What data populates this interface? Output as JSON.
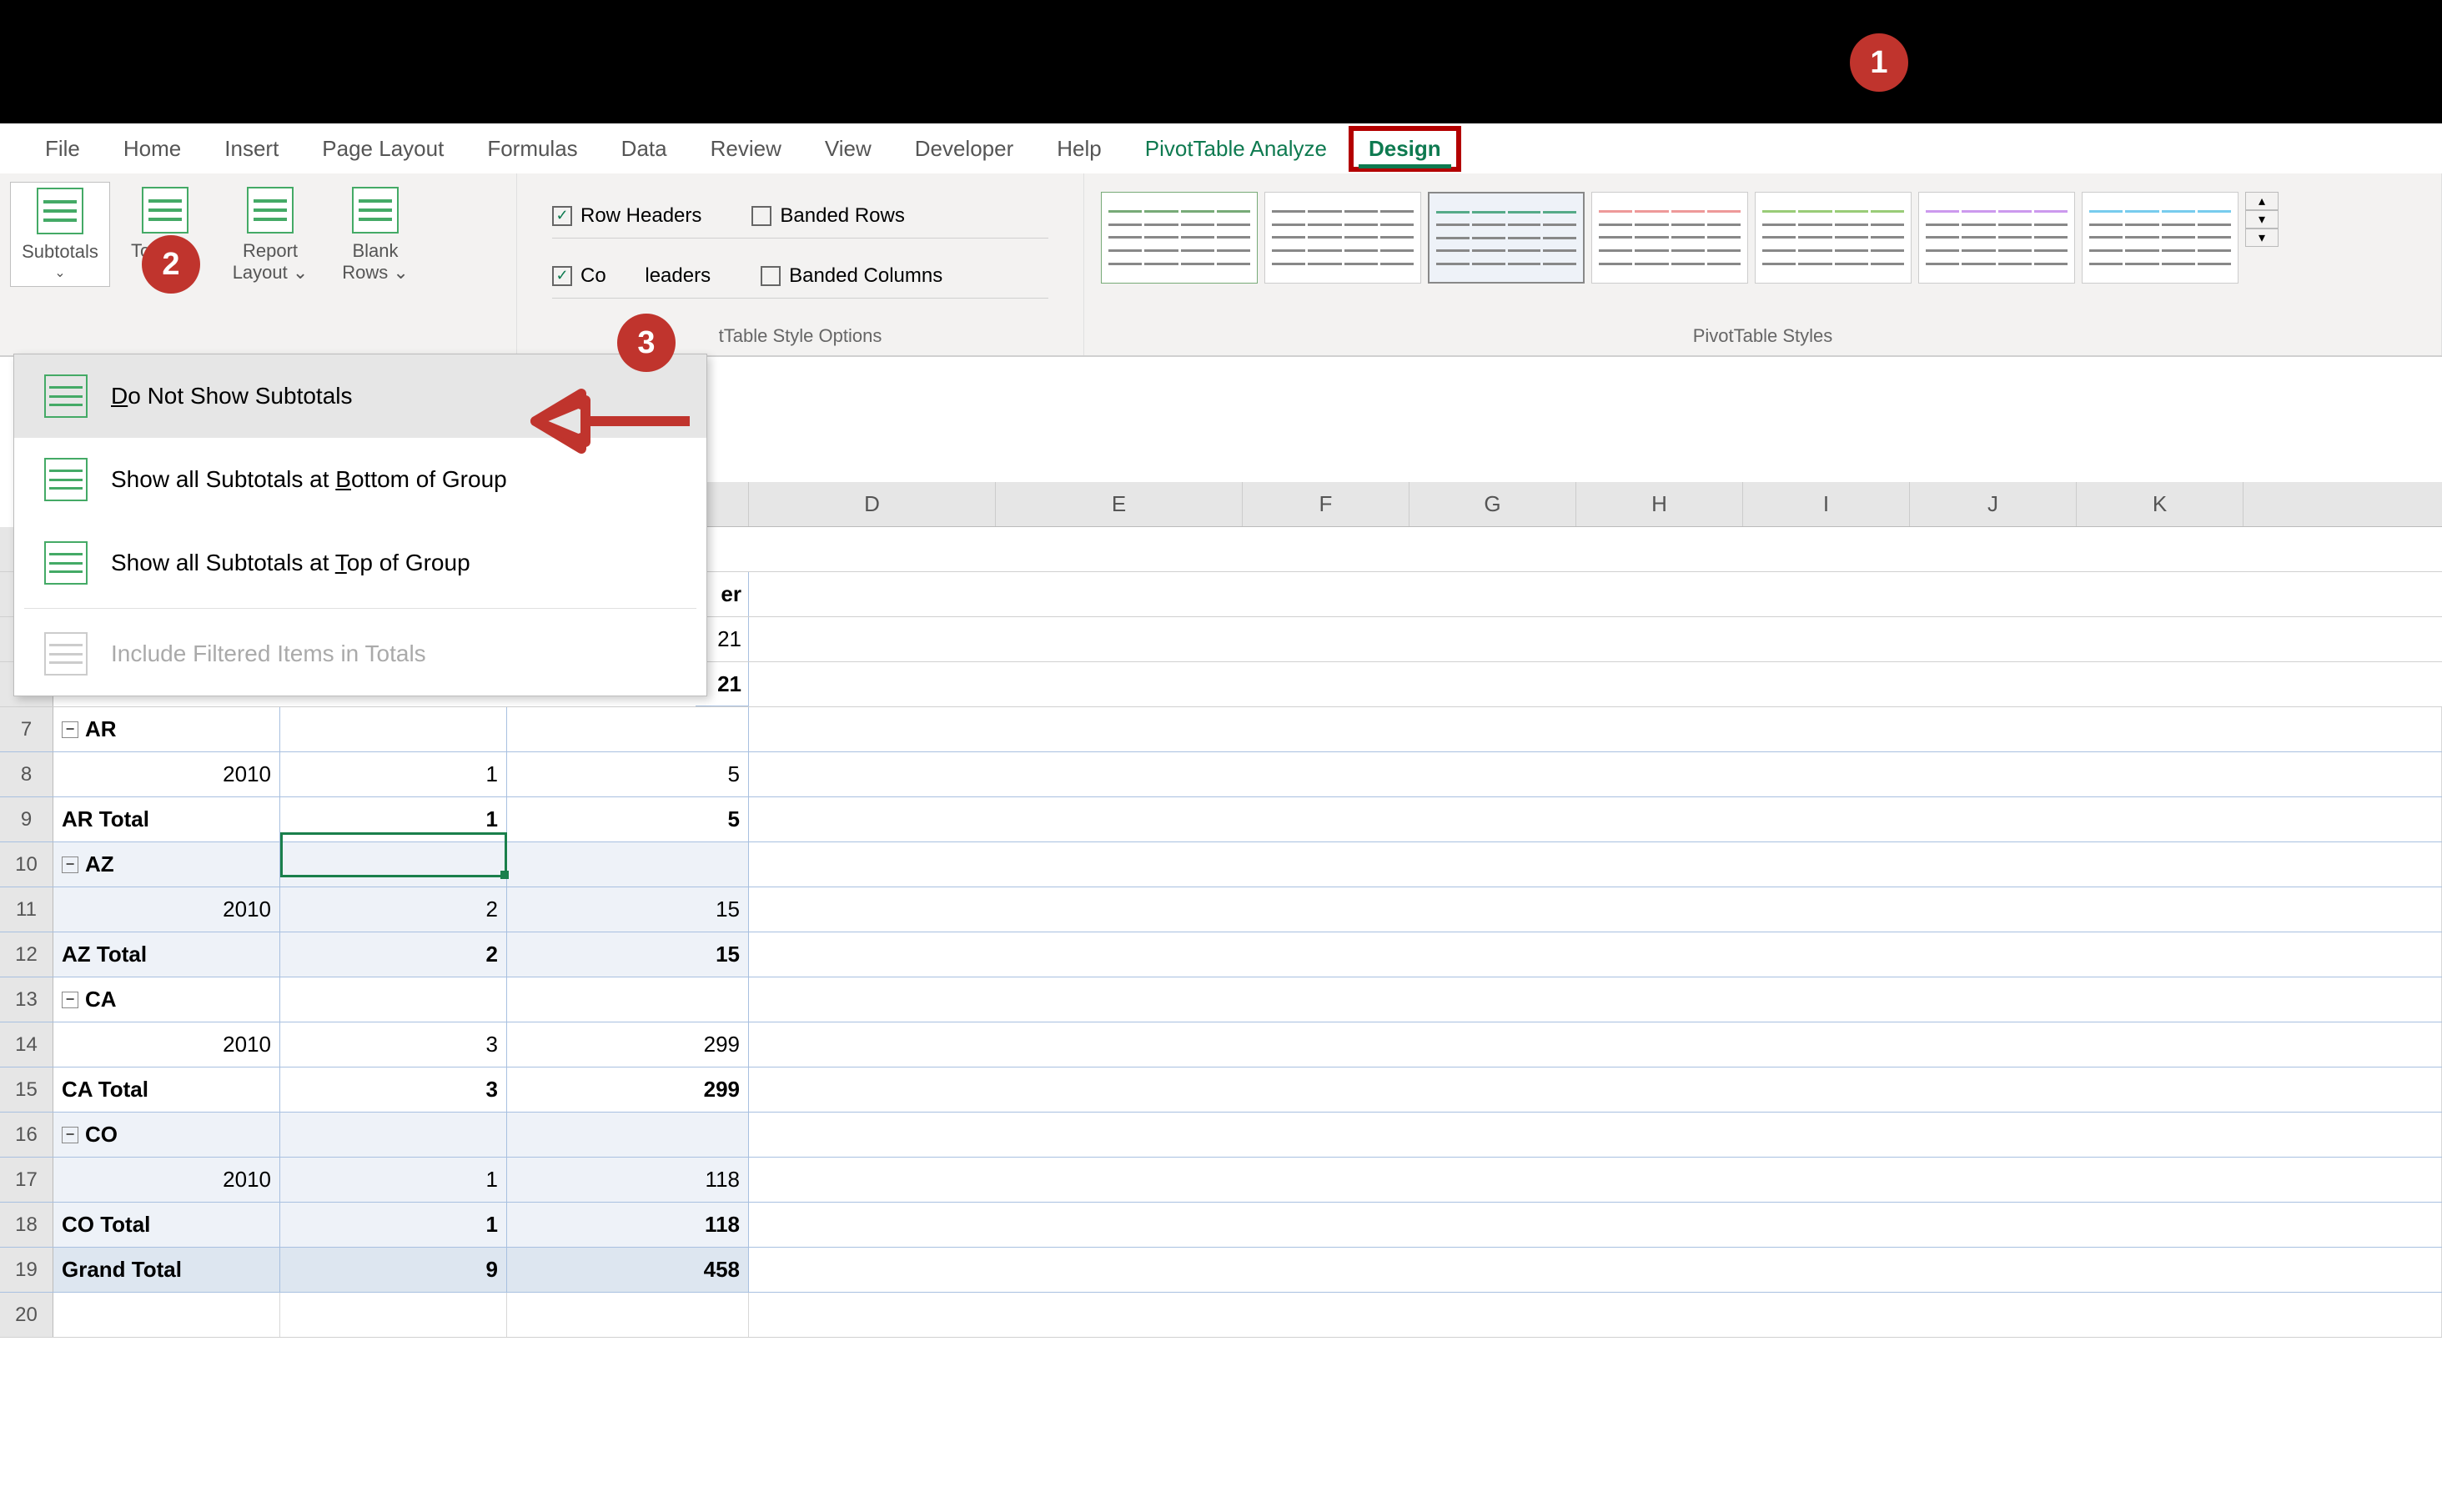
{
  "ribbon": {
    "tabs": [
      "File",
      "Home",
      "Insert",
      "Page Layout",
      "Formulas",
      "Data",
      "Review",
      "View",
      "Developer",
      "Help",
      "PivotTable Analyze",
      "Design"
    ],
    "layout_group": {
      "buttons": [
        {
          "label": "Subtotals",
          "chev": true,
          "selected": true
        },
        {
          "label": "Grand Totals",
          "partial": "Totals",
          "chev": true
        },
        {
          "label": "Report Layout",
          "chev": true
        },
        {
          "label": "Blank Rows",
          "chev": true
        }
      ]
    },
    "style_options": {
      "row_headers": {
        "label": "Row Headers",
        "checked": true
      },
      "banded_rows": {
        "label": "Banded Rows",
        "checked": false
      },
      "col_headers": {
        "label": "Column Headers",
        "partial_visible": "leaders",
        "checked": true,
        "prefix": "Co"
      },
      "banded_cols": {
        "label": "Banded Columns",
        "checked": false
      },
      "group_label": "PivotTable Style Options",
      "group_label_partial": "tTable Style Options"
    },
    "styles_group_label": "PivotTable Styles"
  },
  "dropdown": {
    "items": [
      {
        "text_pre": "",
        "u": "D",
        "text_post": "o Not Show Subtotals"
      },
      {
        "text_pre": "Show all Subtotals at ",
        "u": "B",
        "text_post": "ottom of Group"
      },
      {
        "text_pre": "Show all Subtotals at ",
        "u": "T",
        "text_post": "op of Group"
      },
      {
        "text_pre": "Include Filtered Items in Totals",
        "u": "",
        "text_post": ""
      }
    ]
  },
  "badges": {
    "b1": "1",
    "b2": "2",
    "b3": "3"
  },
  "columns": [
    "D",
    "E",
    "F",
    "G",
    "H",
    "I",
    "J",
    "K"
  ],
  "fragment_rows": {
    "er": "er",
    "r1": "21",
    "r2": "21"
  },
  "rows": [
    {
      "n": "7",
      "a": "AR",
      "b": "",
      "c": "",
      "collapse": true,
      "bold": true,
      "shade": false
    },
    {
      "n": "8",
      "a": "2010",
      "b": "1",
      "c": "5",
      "indent": true
    },
    {
      "n": "9",
      "a": "AR Total",
      "b": "1",
      "c": "5",
      "bold": true
    },
    {
      "n": "10",
      "a": "AZ",
      "b": "",
      "c": "",
      "collapse": true,
      "bold": true,
      "shade": true
    },
    {
      "n": "11",
      "a": "2010",
      "b": "2",
      "c": "15",
      "indent": true,
      "shade": true
    },
    {
      "n": "12",
      "a": "AZ Total",
      "b": "2",
      "c": "15",
      "bold": true,
      "shade": true
    },
    {
      "n": "13",
      "a": "CA",
      "b": "",
      "c": "",
      "collapse": true,
      "bold": true
    },
    {
      "n": "14",
      "a": "2010",
      "b": "3",
      "c": "299",
      "indent": true
    },
    {
      "n": "15",
      "a": "CA Total",
      "b": "3",
      "c": "299",
      "bold": true
    },
    {
      "n": "16",
      "a": "CO",
      "b": "",
      "c": "",
      "collapse": true,
      "bold": true,
      "shade": true
    },
    {
      "n": "17",
      "a": "2010",
      "b": "1",
      "c": "118",
      "indent": true,
      "shade": true
    },
    {
      "n": "18",
      "a": "CO Total",
      "b": "1",
      "c": "118",
      "bold": true,
      "shade": true
    },
    {
      "n": "19",
      "a": "Grand Total",
      "b": "9",
      "c": "458",
      "bold": true,
      "shade_grand": true
    },
    {
      "n": "20",
      "a": "",
      "b": "",
      "c": "",
      "plain": true
    }
  ]
}
